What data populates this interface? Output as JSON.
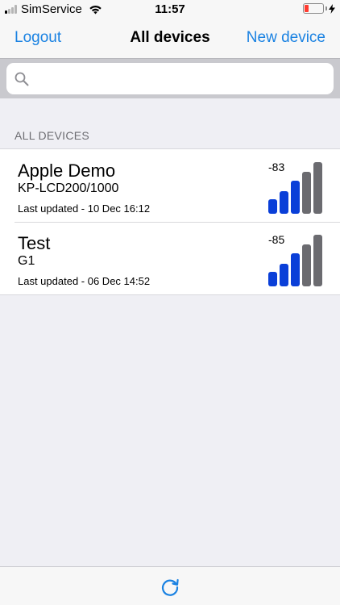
{
  "status_bar": {
    "carrier": "SimService",
    "time": "11:57",
    "signal_bars_active": 1
  },
  "nav": {
    "left_label": "Logout",
    "title": "All devices",
    "right_label": "New device"
  },
  "search": {
    "value": "",
    "placeholder": ""
  },
  "section": {
    "header": "ALL DEVICES"
  },
  "devices": [
    {
      "name": "Apple Demo",
      "model": "KP-LCD200/1000",
      "updated": "Last updated - 10 Dec 16:12",
      "rssi": "-83",
      "signal_level": 3
    },
    {
      "name": "Test",
      "model": "G1",
      "updated": "Last updated - 06 Dec 14:52",
      "rssi": "-85",
      "signal_level": 3
    }
  ],
  "colors": {
    "accent": "#1a82e2",
    "signal_active": "#0a3fd8",
    "signal_inactive": "#6b6b70"
  },
  "toolbar": {
    "refresh_icon": "refresh-icon"
  }
}
